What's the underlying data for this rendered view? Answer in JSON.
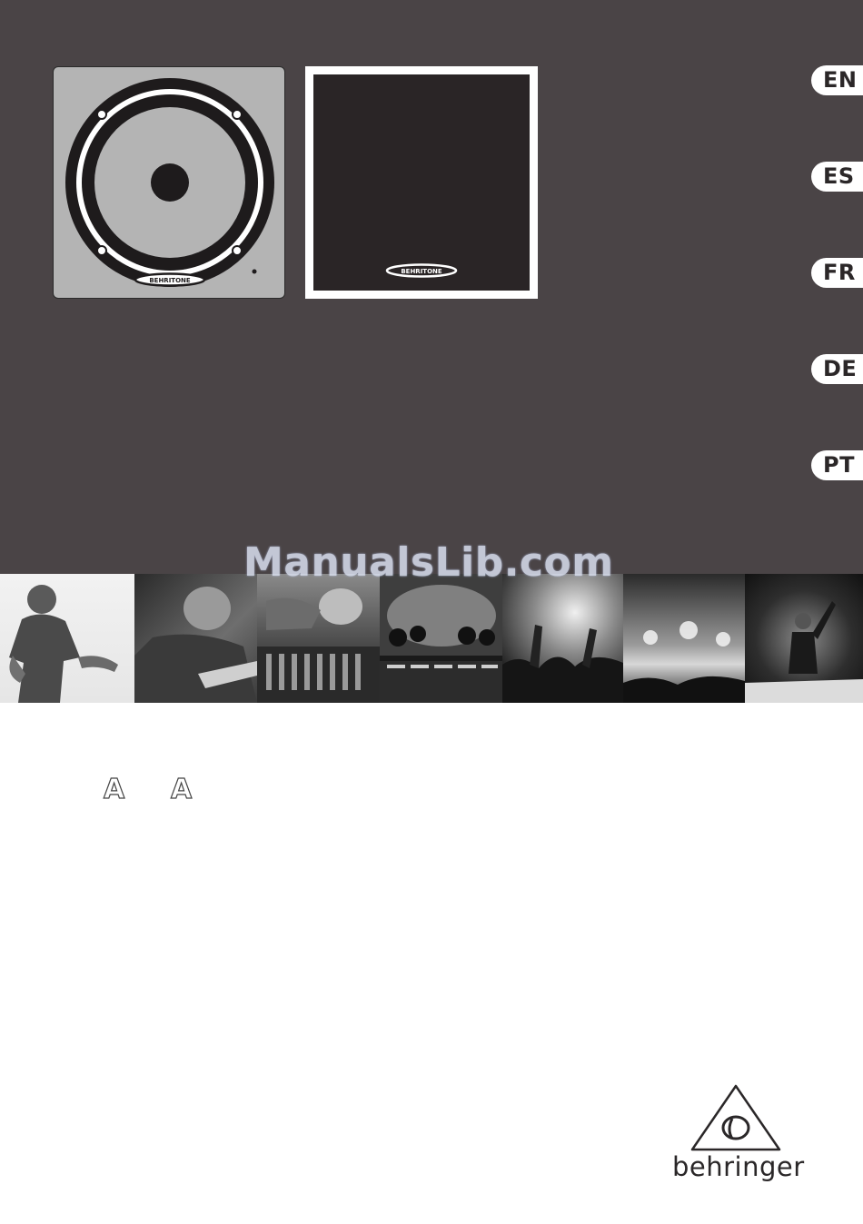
{
  "languages": [
    "EN",
    "ES",
    "FR",
    "DE",
    "PT"
  ],
  "product": {
    "badge_grey": "BEHRITONE",
    "badge_black": "BEHRITONE"
  },
  "watermark": "ManualsLib.com",
  "outline_letters": [
    "A",
    "A"
  ],
  "brand": {
    "name": "behringer"
  },
  "colors": {
    "top_background": "#4a4446",
    "tab_background": "#ffffff",
    "watermark": "#d9dfef"
  },
  "photos": [
    {
      "icon": "performer-photo"
    },
    {
      "icon": "guitarist-photo"
    },
    {
      "icon": "mixing-engineer-photo"
    },
    {
      "icon": "stage-console-photo"
    },
    {
      "icon": "crowd-photo"
    },
    {
      "icon": "stage-lights-photo"
    },
    {
      "icon": "singer-on-stage-photo"
    }
  ]
}
